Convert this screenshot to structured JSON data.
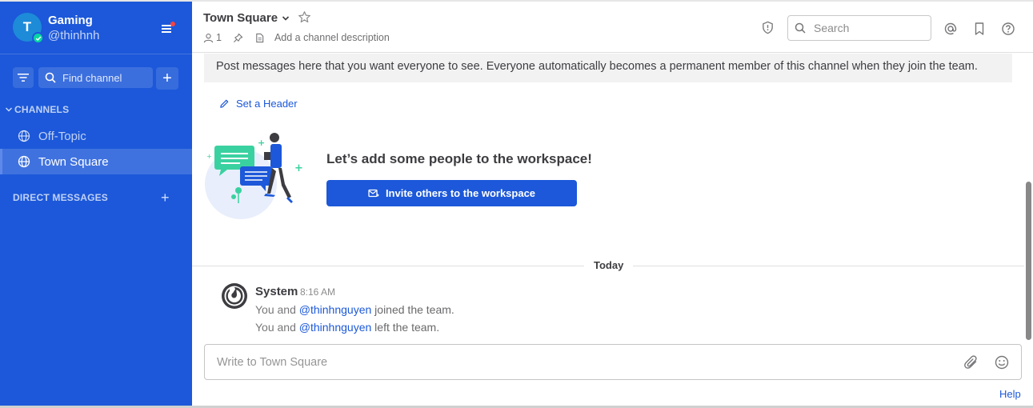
{
  "sidebar": {
    "team_initial": "T",
    "team_name": "Gaming",
    "user_handle": "@thinhnh",
    "find_channel_placeholder": "Find channel",
    "add_label": "+",
    "channels_header": "CHANNELS",
    "channels": [
      {
        "label": "Off-Topic",
        "active": false
      },
      {
        "label": "Town Square",
        "active": true
      }
    ],
    "dm_header": "DIRECT MESSAGES",
    "dm_add": "+"
  },
  "header": {
    "channel_name": "Town Square",
    "member_count": "1",
    "description_placeholder": "Add a channel description",
    "search_placeholder": "Search"
  },
  "main": {
    "intro_text": "Post messages here that you want everyone to see. Everyone automatically becomes a permanent member of this channel when they join the team.",
    "set_header_label": "Set a Header",
    "invite_title": "Let’s add some people to the workspace!",
    "invite_button": "Invite others to the workspace",
    "date_separator": "Today",
    "post": {
      "author": "System",
      "time": "8:16 AM",
      "lines": [
        {
          "prefix": "You and ",
          "mention": "@thinhnguyen",
          "suffix": " joined the team."
        },
        {
          "prefix": "You and ",
          "mention": "@thinhnguyen",
          "suffix": " left the team."
        }
      ]
    }
  },
  "composer": {
    "placeholder": "Write to Town Square"
  },
  "footer": {
    "help_label": "Help"
  },
  "colors": {
    "sidebar_bg": "#1c58d9",
    "accent": "#1c58d9",
    "online_status": "#06d6a0",
    "badge": "#f74343"
  },
  "icons": [
    "check-icon",
    "menu-icon",
    "filter-icon",
    "search-icon",
    "globe-icon",
    "chevron-down-icon",
    "star-icon",
    "member-icon",
    "pin-icon",
    "document-icon",
    "shield-icon",
    "at-icon",
    "bookmark-icon",
    "help-icon",
    "pencil-icon",
    "invite-icon",
    "mattermost-logo-icon",
    "paperclip-icon",
    "emoji-icon"
  ]
}
